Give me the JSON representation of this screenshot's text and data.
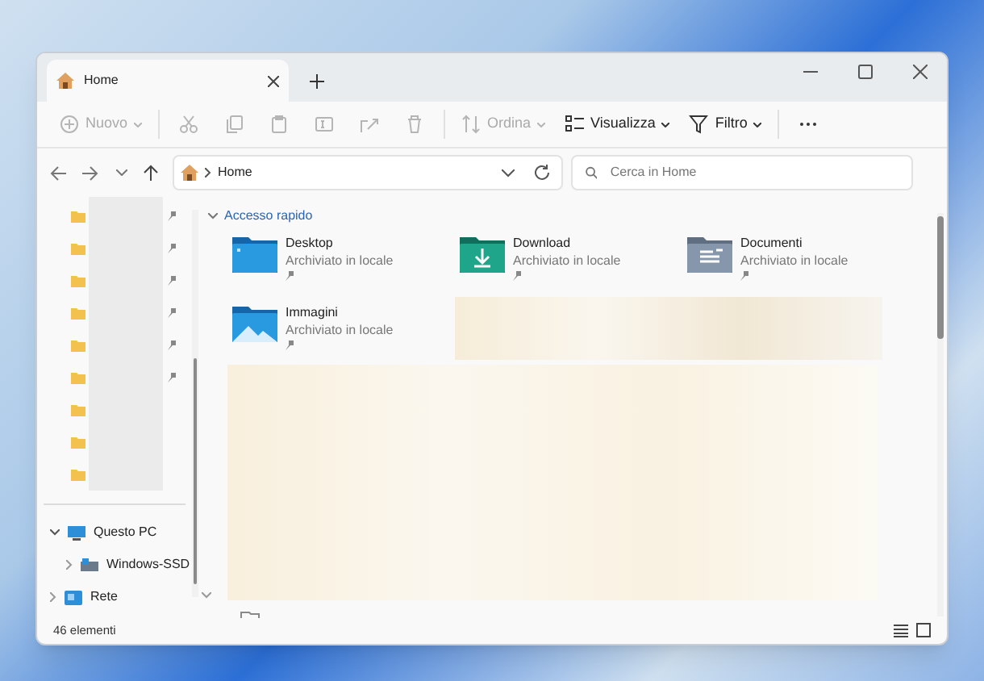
{
  "window": {
    "tab": {
      "title": "Home",
      "selected": true
    }
  },
  "toolbar": [
    {
      "kind": "new",
      "label": "Nuovo",
      "disabled": true
    },
    {
      "kind": "cut",
      "disabled": true
    },
    {
      "kind": "copy",
      "disabled": true
    },
    {
      "kind": "paste",
      "disabled": true
    },
    {
      "kind": "rename",
      "disabled": true
    },
    {
      "kind": "share",
      "disabled": true
    },
    {
      "kind": "delete",
      "disabled": true
    },
    {
      "kind": "sort",
      "label": "Ordina",
      "disabled": true
    },
    {
      "kind": "view",
      "label": "Visualizza",
      "disabled": false
    },
    {
      "kind": "filter",
      "label": "Filtro",
      "disabled": false
    },
    {
      "kind": "more",
      "disabled": false
    }
  ],
  "address": {
    "path": "Home"
  },
  "search": {
    "placeholder": "Cerca in Home"
  },
  "sidebar": {
    "quick_access": [
      {
        "pinned": true
      },
      {
        "pinned": true
      },
      {
        "pinned": true
      },
      {
        "pinned": true
      },
      {
        "pinned": true
      },
      {
        "pinned": true
      },
      {
        "pinned": false
      },
      {
        "pinned": false
      },
      {
        "pinned": false
      }
    ],
    "tree": [
      {
        "label": "Questo PC",
        "kind": "pc",
        "expanded": true,
        "children": [
          {
            "label": "Windows-SSD",
            "kind": "drive",
            "expanded": false
          }
        ]
      },
      {
        "label": "Rete",
        "kind": "network",
        "expanded": false
      }
    ]
  },
  "quick_access": {
    "title": "Accesso rapido",
    "expanded": true,
    "items": [
      {
        "name": "Desktop",
        "subtitle": "Archiviato in locale",
        "kind": "desktop",
        "pinned": true
      },
      {
        "name": "Download",
        "subtitle": "Archiviato in locale",
        "kind": "download",
        "pinned": true
      },
      {
        "name": "Documenti",
        "subtitle": "Archiviato in locale",
        "kind": "documents",
        "pinned": true
      },
      {
        "name": "Immagini",
        "subtitle": "Archiviato in locale",
        "kind": "pictures",
        "pinned": true
      }
    ]
  },
  "status_bar": {
    "count": "46 elementi"
  }
}
